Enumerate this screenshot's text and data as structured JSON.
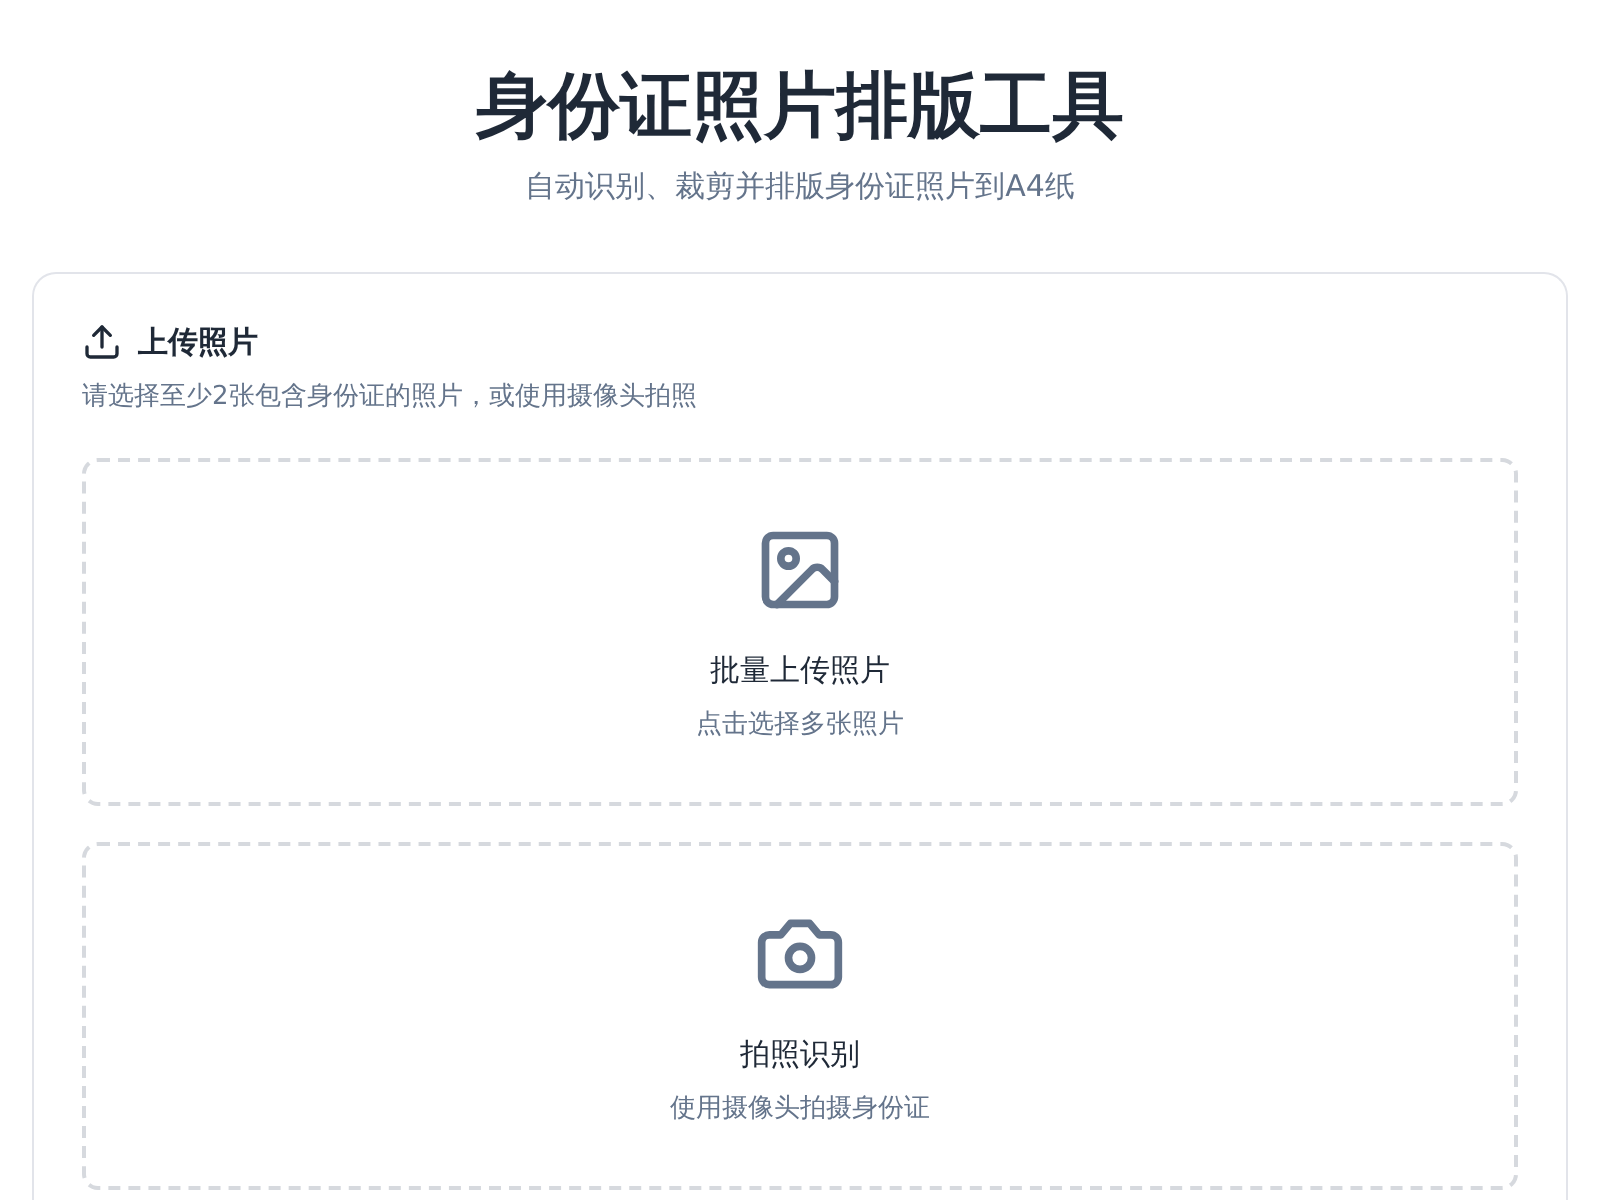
{
  "header": {
    "title": "身份证照片排版工具",
    "subtitle": "自动识别、裁剪并排版身份证照片到A4纸"
  },
  "upload_card": {
    "title": "上传照片",
    "description": "请选择至少2张包含身份证的照片，或使用摄像头拍照",
    "options": [
      {
        "kind": "gallery",
        "label": "批量上传照片",
        "hint": "点击选择多张照片"
      },
      {
        "kind": "camera",
        "label": "拍照识别",
        "hint": "使用摄像头拍摄身份证"
      }
    ]
  }
}
